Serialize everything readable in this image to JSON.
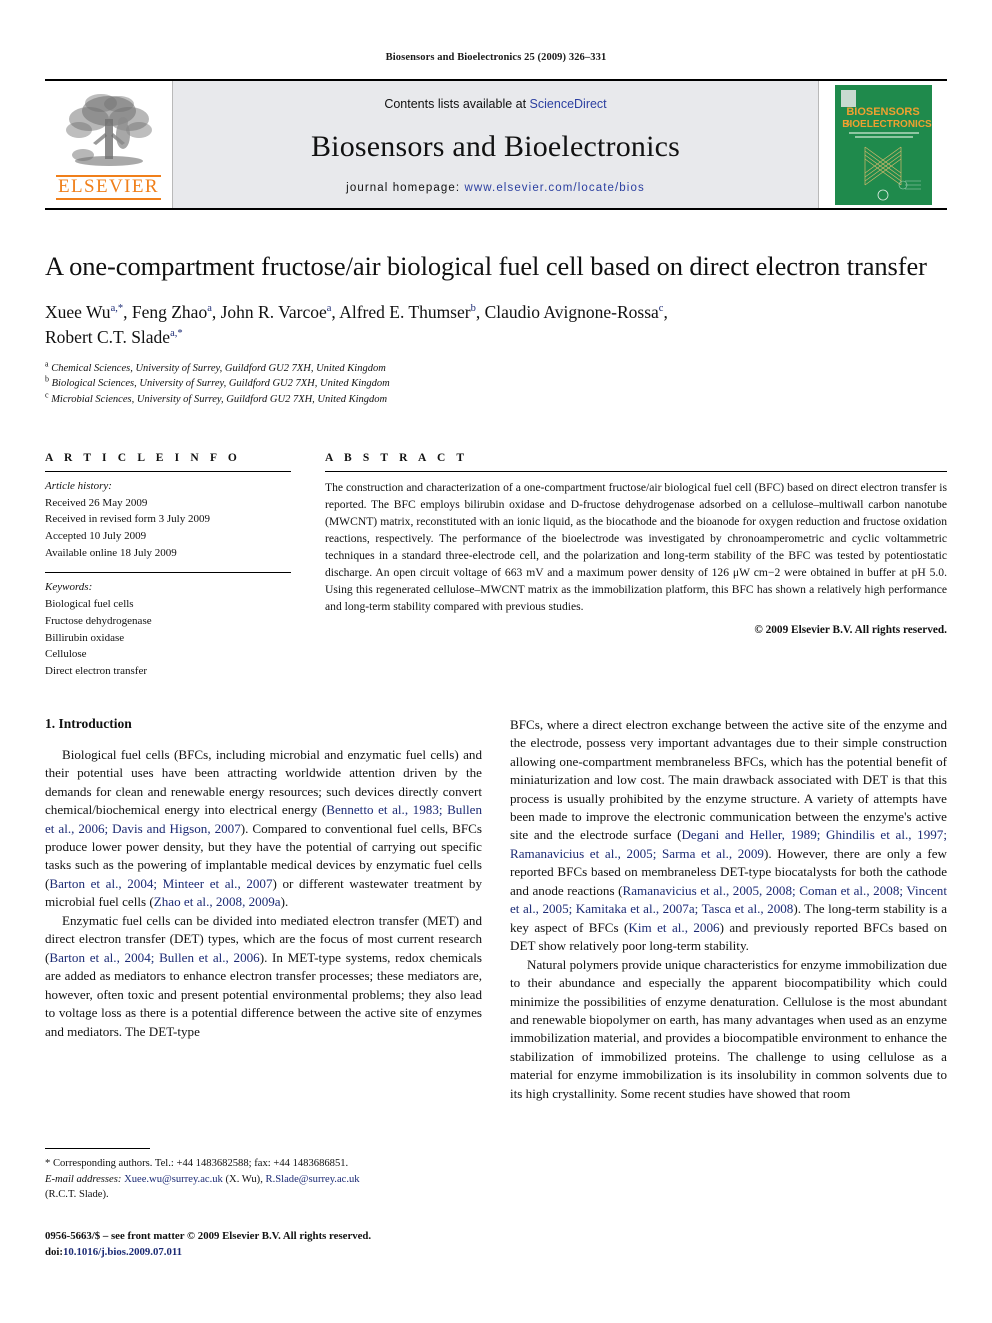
{
  "running_head": "Biosensors and Bioelectronics 25 (2009) 326–331",
  "masthead": {
    "contents_prefix": "Contents lists available at ",
    "sciencedirect": "ScienceDirect",
    "journal_title": "Biosensors and Bioelectronics",
    "homepage_prefix": "journal homepage: ",
    "homepage_url": "www.elsevier.com/locate/bios",
    "publisher_wordmark": "ELSEVIER",
    "cover_title_line1": "BIOSENSORS",
    "cover_title_amp": "&",
    "cover_title_line2": "BIOELECTRONICS",
    "accent_orange": "#f07f1a",
    "cover_green": "#1f8a4c",
    "link_blue": "#2b3fa0"
  },
  "article": {
    "title": "A one-compartment fructose/air biological fuel cell based on direct electron transfer",
    "authors_line1_html": "Xuee Wu<sup>a,*</sup>, Feng Zhao<sup>a</sup>, John R. Varcoe<sup>a</sup>, Alfred E. Thumser<sup>b</sup>, Claudio Avignone-Rossa<sup>c</sup>,",
    "authors_line2_html": "Robert C.T. Slade<sup>a,*</sup>",
    "affiliations": [
      {
        "mark": "a",
        "text": "Chemical Sciences, University of Surrey, Guildford GU2 7XH, United Kingdom"
      },
      {
        "mark": "b",
        "text": "Biological Sciences, University of Surrey, Guildford GU2 7XH, United Kingdom"
      },
      {
        "mark": "c",
        "text": "Microbial Sciences, University of Surrey, Guildford GU2 7XH, United Kingdom"
      }
    ]
  },
  "article_info": {
    "label": "A R T I C L E    I N F O",
    "history_label": "Article history:",
    "history": [
      "Received 26 May 2009",
      "Received in revised form 3 July 2009",
      "Accepted 10 July 2009",
      "Available online 18 July 2009"
    ],
    "keywords_label": "Keywords:",
    "keywords": [
      "Biological fuel cells",
      "Fructose dehydrogenase",
      "Billirubin oxidase",
      "Cellulose",
      "Direct electron transfer"
    ]
  },
  "abstract": {
    "label": "A B S T R A C T",
    "text": "The construction and characterization of a one-compartment fructose/air biological fuel cell (BFC) based on direct electron transfer is reported. The BFC employs bilirubin oxidase and D-fructose dehydrogenase adsorbed on a cellulose–multiwall carbon nanotube (MWCNT) matrix, reconstituted with an ionic liquid, as the biocathode and the bioanode for oxygen reduction and fructose oxidation reactions, respectively. The performance of the bioelectrode was investigated by chronoamperometric and cyclic voltammetric techniques in a standard three-electrode cell, and the polarization and long-term stability of the BFC was tested by potentiostatic discharge. An open circuit voltage of 663 mV and a maximum power density of 126 μW cm−2 were obtained in buffer at pH 5.0. Using this regenerated cellulose–MWCNT matrix as the immobilization platform, this BFC has shown a relatively high performance and long-term stability compared with previous studies.",
    "copyright": "© 2009 Elsevier B.V. All rights reserved."
  },
  "introduction": {
    "heading": "1.  Introduction",
    "left_paragraphs": [
      {
        "segments": [
          {
            "t": "Biological fuel cells (BFCs, including microbial and enzymatic fuel cells) and their potential uses have been attracting worldwide attention driven by the demands for clean and renewable energy resources; such devices directly convert chemical/biochemical energy into electrical energy (",
            "c": false
          },
          {
            "t": "Bennetto et al., 1983; Bullen et al., 2006; Davis and Higson, 2007",
            "c": true
          },
          {
            "t": "). Compared to conventional fuel cells, BFCs produce lower power density, but they have the potential of carrying out specific tasks such as the powering of implantable medical devices by enzymatic fuel cells (",
            "c": false
          },
          {
            "t": "Barton et al., 2004; Minteer et al., 2007",
            "c": true
          },
          {
            "t": ") or different wastewater treatment by microbial fuel cells (",
            "c": false
          },
          {
            "t": "Zhao et al., 2008, 2009a",
            "c": true
          },
          {
            "t": ").",
            "c": false
          }
        ]
      },
      {
        "segments": [
          {
            "t": "Enzymatic fuel cells can be divided into mediated electron transfer (MET) and direct electron transfer (DET) types, which are the focus of most current research (",
            "c": false
          },
          {
            "t": "Barton et al., 2004; Bullen et al., 2006",
            "c": true
          },
          {
            "t": "). In MET-type systems, redox chemicals are added as mediators to enhance electron transfer processes; these mediators are, however, often toxic and present potential environmental problems; they also lead to voltage loss as there is a potential difference between the active site of enzymes and mediators. The DET-type",
            "c": false
          }
        ]
      }
    ],
    "right_paragraphs": [
      {
        "continuation": true,
        "segments": [
          {
            "t": "BFCs, where a direct electron exchange between the active site of the enzyme and the electrode, possess very important advantages due to their simple construction allowing one-compartment membraneless BFCs, which has the potential benefit of miniaturization and low cost. The main drawback associated with DET is that this process is usually prohibited by the enzyme structure. A variety of attempts have been made to improve the electronic communication between the enzyme's active site and the electrode surface (",
            "c": false
          },
          {
            "t": "Degani and Heller, 1989; Ghindilis et al., 1997; Ramanavicius et al., 2005; Sarma et al., 2009",
            "c": true
          },
          {
            "t": "). However, there are only a few reported BFCs based on membraneless DET-type biocatalysts for both the cathode and anode reactions (",
            "c": false
          },
          {
            "t": "Ramanavicius et al., 2005, 2008; Coman et al., 2008; Vincent et al., 2005; Kamitaka et al., 2007a; Tasca et al., 2008",
            "c": true
          },
          {
            "t": "). The long-term stability is a key aspect of BFCs (",
            "c": false
          },
          {
            "t": "Kim et al., 2006",
            "c": true
          },
          {
            "t": ") and previously reported BFCs based on DET show relatively poor long-term stability.",
            "c": false
          }
        ]
      },
      {
        "continuation": false,
        "segments": [
          {
            "t": "Natural polymers provide unique characteristics for enzyme immobilization due to their abundance and especially the apparent biocompatibility which could minimize the possibilities of enzyme denaturation. Cellulose is the most abundant and renewable biopolymer on earth, has many advantages when used as an enzyme immobilization material, and provides a biocompatible environment to enhance the stabilization of immobilized proteins. The challenge to using cellulose as a material for enzyme immobilization is its insolubility in common solvents due to its high crystallinity. Some recent studies have showed that room",
            "c": false
          }
        ]
      }
    ]
  },
  "footnotes": {
    "corresponding": "*  Corresponding authors. Tel.: +44 1483682588; fax: +44 1483686851.",
    "email_label": "E-mail addresses:",
    "email1": "Xuee.wu@surrey.ac.uk",
    "email1_owner": "(X. Wu),",
    "email2": "R.Slade@surrey.ac.uk",
    "email2_owner": "(R.C.T. Slade)."
  },
  "imprint": {
    "front_matter": "0956-5663/$ – see front matter © 2009 Elsevier B.V. All rights reserved.",
    "doi_label": "doi:",
    "doi": "10.1016/j.bios.2009.07.011"
  }
}
